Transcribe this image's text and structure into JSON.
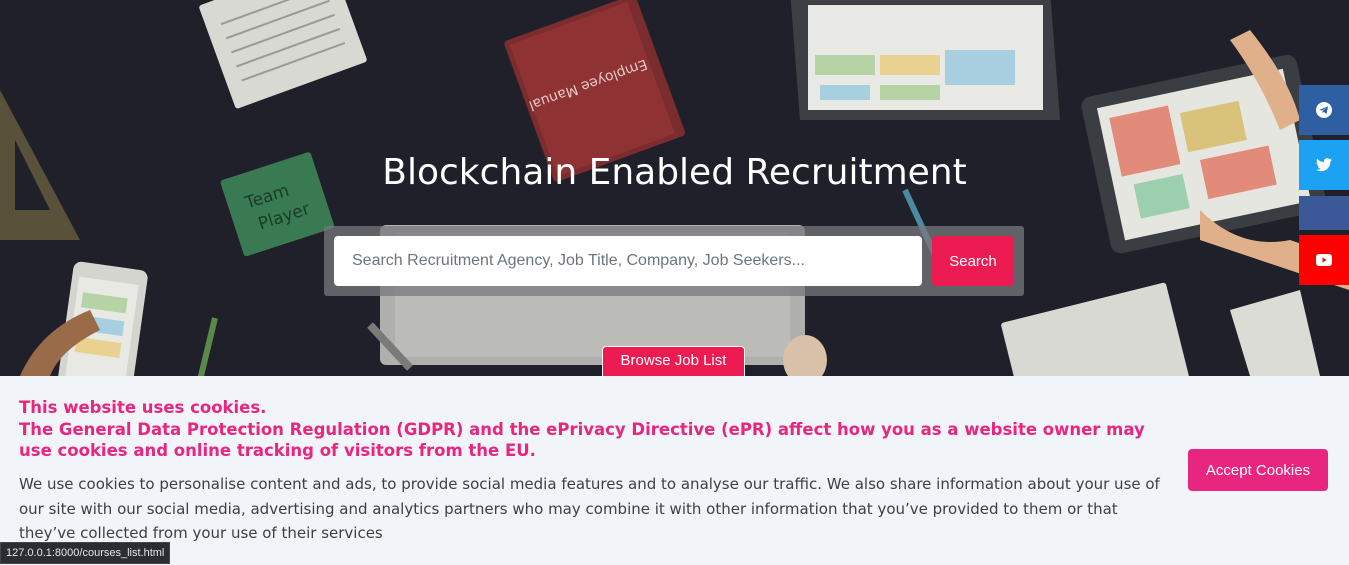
{
  "hero": {
    "title": "Blockchain Enabled Recruitment",
    "browse_label": "Browse Job List",
    "art_text": "Team Player",
    "book_text": "Employee Manual"
  },
  "search": {
    "placeholder": "Search Recruitment Agency, Job Title, Company, Job Seekers...",
    "button_label": "Search"
  },
  "social": [
    {
      "name": "telegram",
      "color": "#2f5fa3"
    },
    {
      "name": "twitter",
      "color": "#1da1f2"
    },
    {
      "name": "facebook",
      "color": "#3b5998"
    },
    {
      "name": "youtube",
      "color": "#ff0000"
    }
  ],
  "cookie": {
    "headline": "This website uses cookies.",
    "regulation": "The General Data Protection Regulation (GDPR) and the ePrivacy Directive (ePR) affect how you as a website owner may use cookies and online tracking of visitors from the EU.",
    "body": "We use cookies to personalise content and ads, to provide social media features and to analyse our traffic. We also share information about your use of our site with our social media, advertising and analytics partners who may combine it with other information that you’ve provided to them or that they’ve collected from your use of their services",
    "accept_label": "Accept Cookies"
  },
  "status_bar": {
    "url": "127.0.0.1:8000/courses_list.html"
  },
  "colors": {
    "accent": "#ec1b52",
    "cookie_accent": "#e8267f",
    "hero_bg": "#1f2029"
  }
}
